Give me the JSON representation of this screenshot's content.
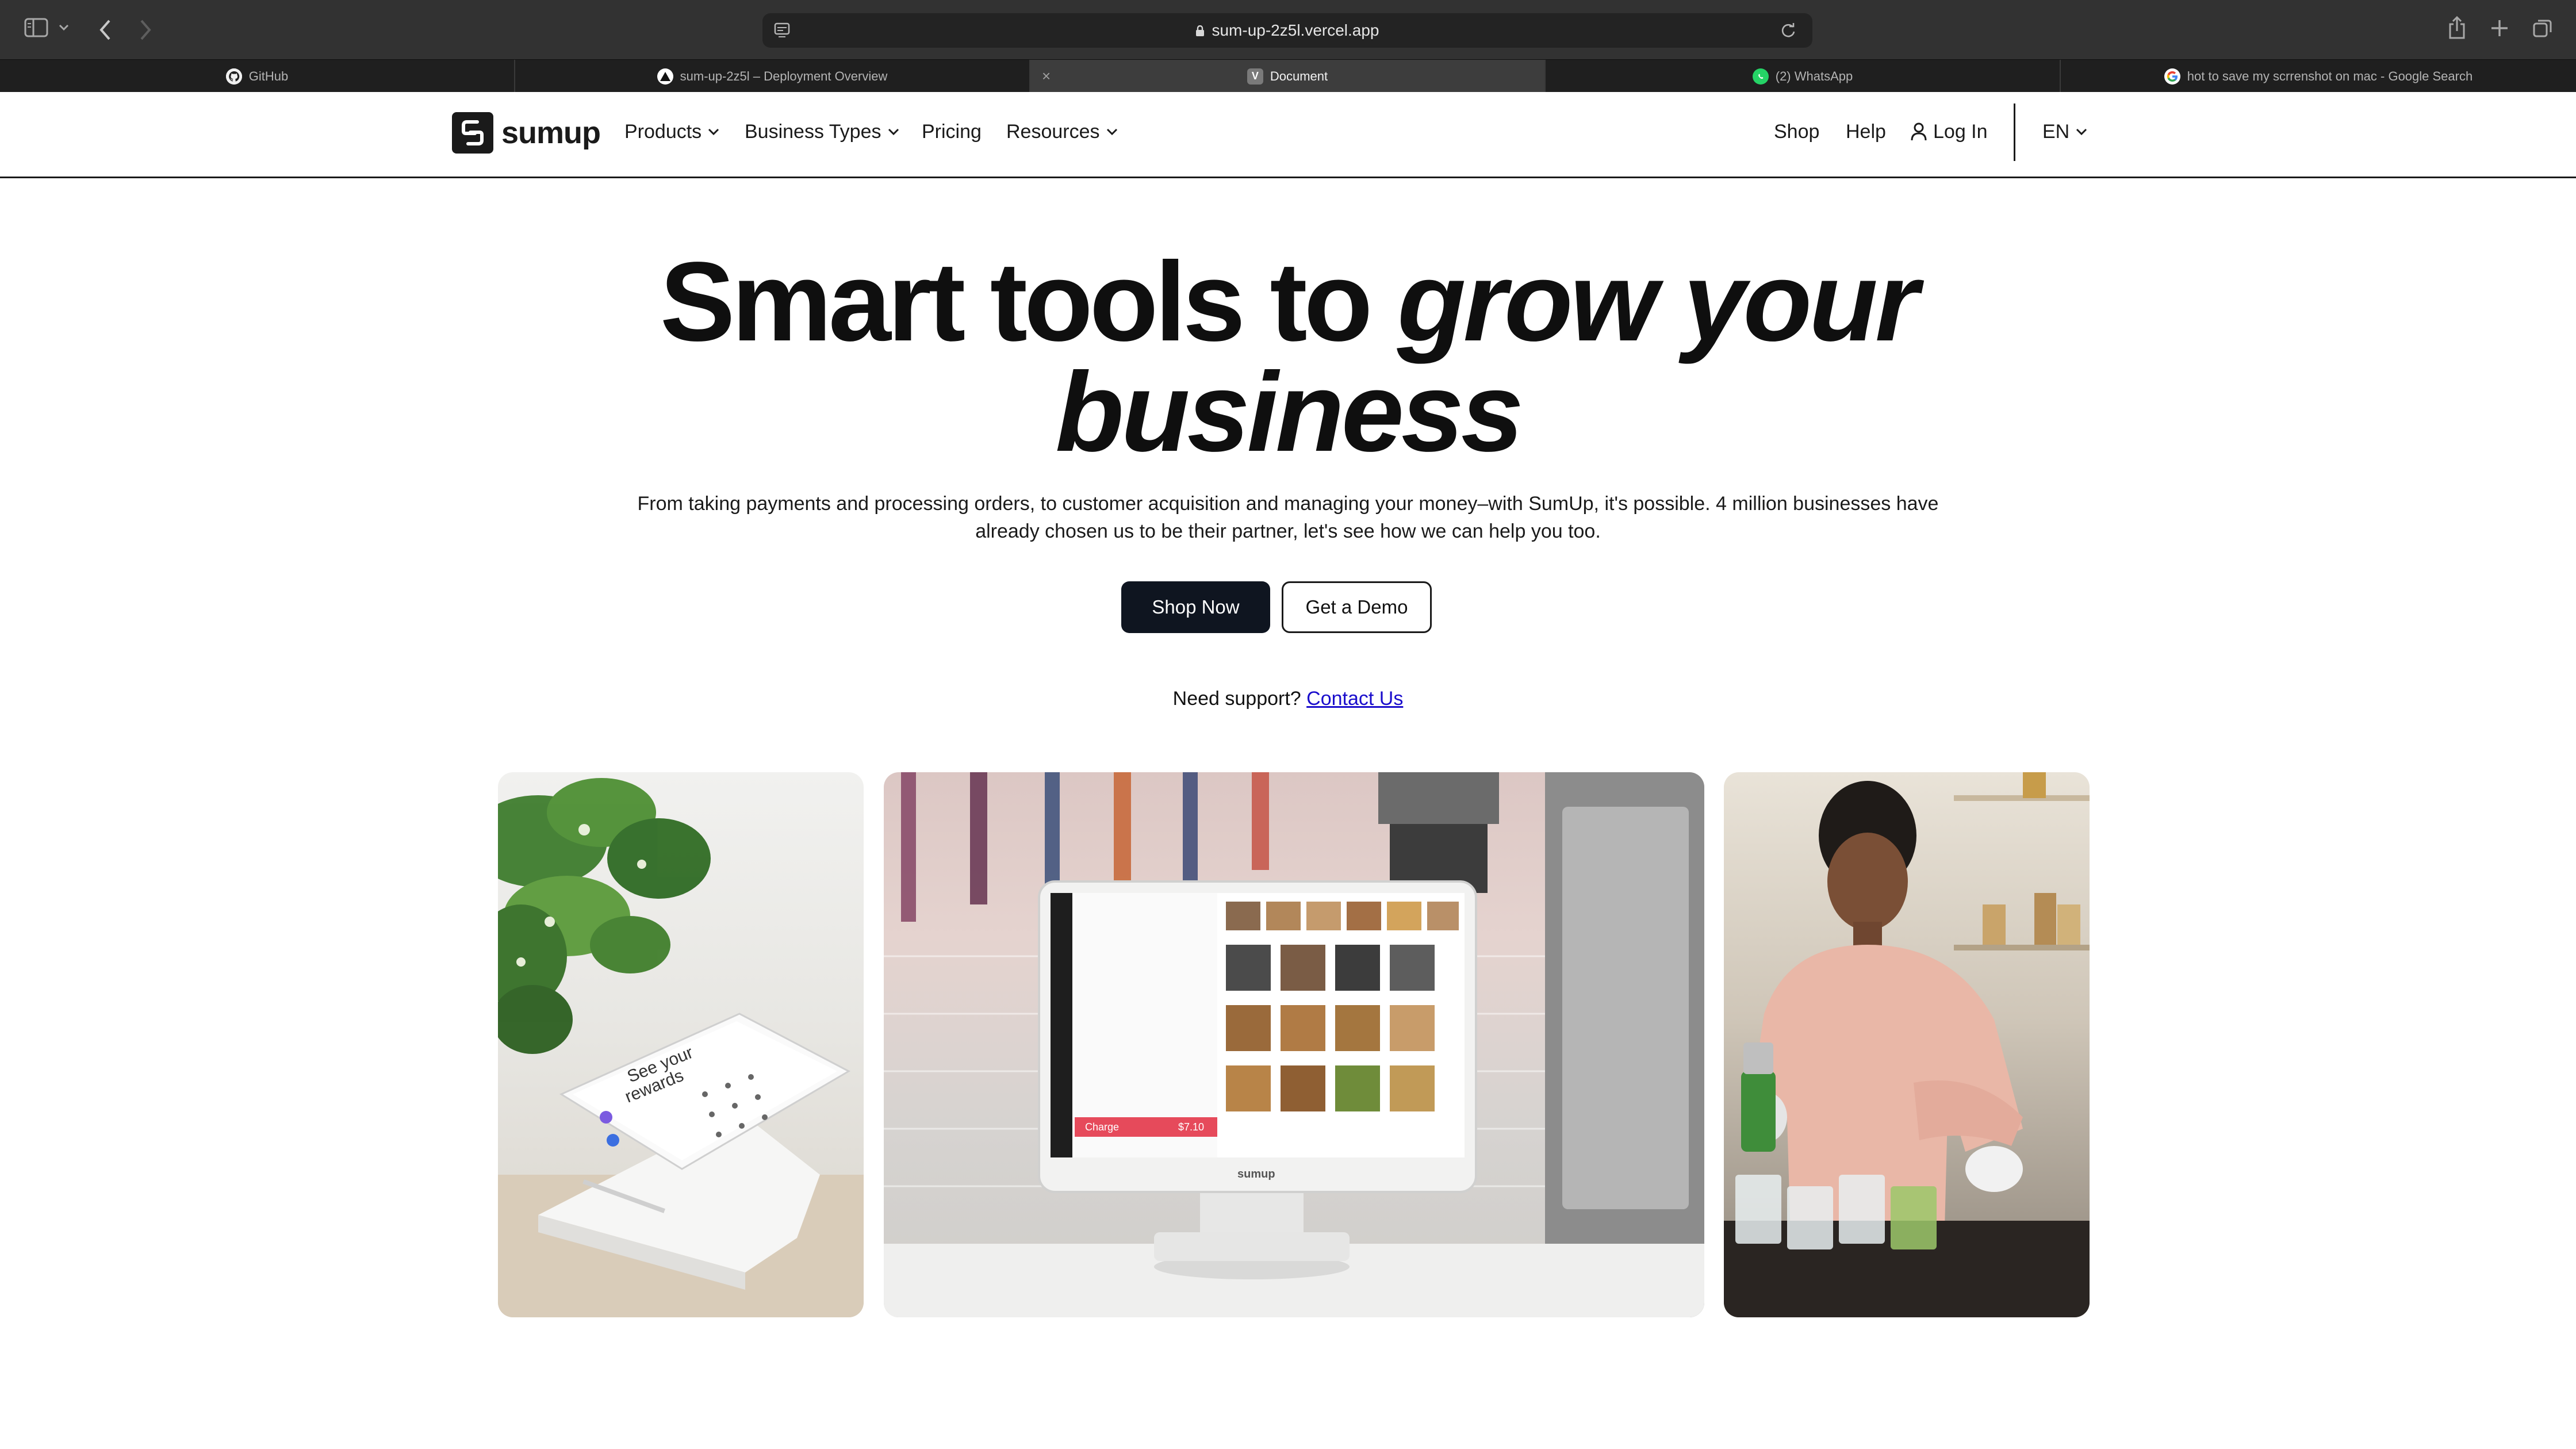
{
  "browser": {
    "url": "sum-up-2z5l.vercel.app",
    "tabs": [
      {
        "label": "GitHub",
        "favicon": "github-icon",
        "active": false
      },
      {
        "label": "sum-up-2z5l – Deployment Overview",
        "favicon": "vercel-icon",
        "active": false
      },
      {
        "label": "Document",
        "favicon": "document-icon",
        "favicon_letter": "V",
        "active": true
      },
      {
        "label": "(2) WhatsApp",
        "favicon": "whatsapp-icon",
        "active": false
      },
      {
        "label": "hot to save my scrrenshot on mac - Google Search",
        "favicon": "google-icon",
        "active": false
      }
    ]
  },
  "header": {
    "logo_text": "sumup",
    "nav": [
      {
        "label": "Products",
        "has_dropdown": true
      },
      {
        "label": "Business Types",
        "has_dropdown": true
      },
      {
        "label": "Pricing",
        "has_dropdown": false
      },
      {
        "label": "Resources",
        "has_dropdown": true
      }
    ],
    "right": {
      "shop": "Shop",
      "help": "Help",
      "login": "Log In",
      "language": "EN"
    }
  },
  "hero": {
    "title_plain": "Smart tools to",
    "title_emphasis_1": "grow your",
    "title_emphasis_2": "business",
    "subtitle": "From taking payments and processing orders, to customer acquisition and managing your money–with SumUp, it's possible. 4 million businesses have already chosen us to be their partner, let's see how we can help you too.",
    "primary_cta": "Shop Now",
    "secondary_cta": "Get a Demo",
    "support_text": "Need support?",
    "support_link": "Contact Us"
  },
  "images": [
    {
      "name": "card-reader-rewards-image"
    },
    {
      "name": "pos-terminal-cafe-image"
    },
    {
      "name": "barista-preparing-drinks-image"
    }
  ],
  "pos_screen": {
    "charge_label": "Charge",
    "charge_amount": "$7.10",
    "brand": "sumup"
  },
  "colors": {
    "brand_dark": "#0f1520",
    "link": "#1a0dcc",
    "chrome_bg": "#323232"
  }
}
